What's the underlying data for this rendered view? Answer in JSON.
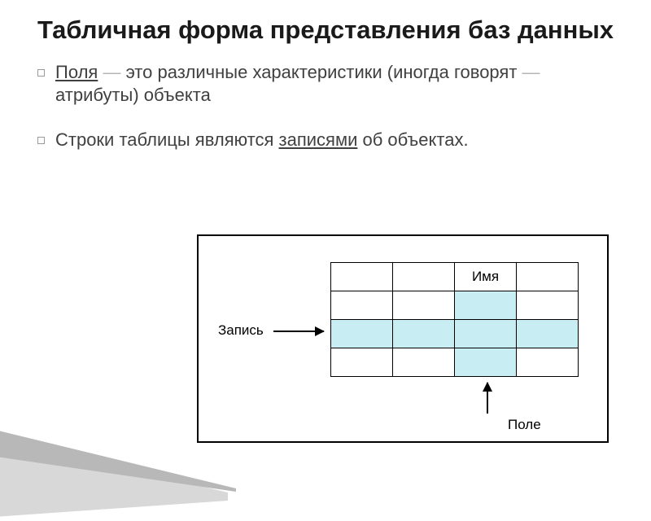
{
  "title": "Табличная форма представления баз данных",
  "bullet1": {
    "term": "Поля",
    "dash": " — ",
    "rest": "это различные характеристики (иногда говорят",
    "dash2": " — ",
    "rest2": "атрибуты) объекта"
  },
  "bullet2": {
    "pre": "Строки таблицы являются ",
    "term": "записями",
    "post": " об объектах."
  },
  "diagram": {
    "column_label": "Имя",
    "row_label": "Запись",
    "field_label": "Поле"
  }
}
